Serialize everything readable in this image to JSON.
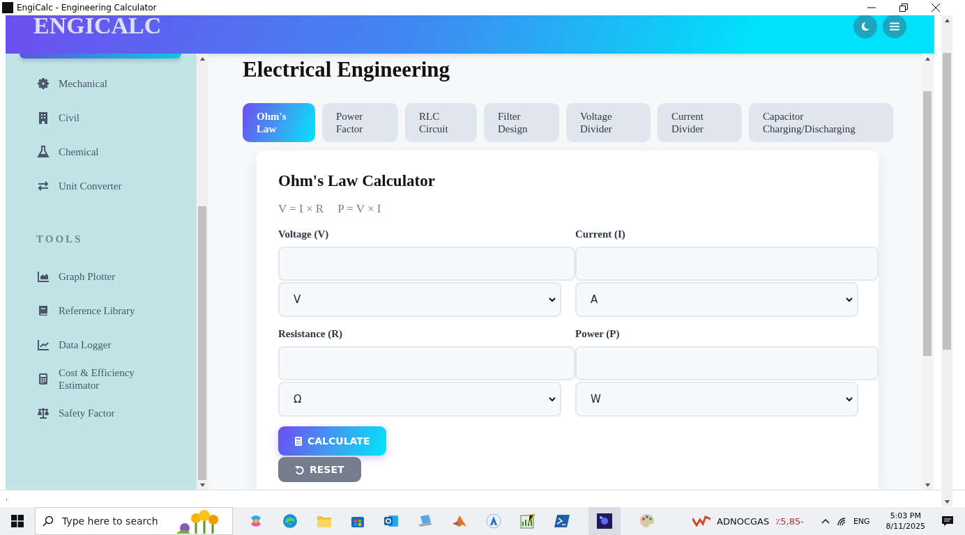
{
  "window": {
    "title": "EngiCalc - Engineering Calculator"
  },
  "header": {
    "logo": "ENGICALC"
  },
  "sidebar": {
    "sections": [
      {
        "items": [
          {
            "label": "Mechanical"
          },
          {
            "label": "Civil"
          },
          {
            "label": "Chemical"
          },
          {
            "label": "Unit Converter"
          }
        ]
      },
      {
        "heading": "TOOLS",
        "items": [
          {
            "label": "Graph Plotter"
          },
          {
            "label": "Reference Library"
          },
          {
            "label": "Data Logger"
          },
          {
            "label": "Cost & Efficiency Estimator"
          },
          {
            "label": "Safety Factor"
          }
        ]
      }
    ]
  },
  "main": {
    "title": "Electrical Engineering",
    "tabs": [
      {
        "label": "Ohm's Law",
        "selected": true
      },
      {
        "label": "Power Factor",
        "selected": false
      },
      {
        "label": "RLC Circuit",
        "selected": false
      },
      {
        "label": "Filter Design",
        "selected": false
      },
      {
        "label": "Voltage Divider",
        "selected": false
      },
      {
        "label": "Current Divider",
        "selected": false
      },
      {
        "label": "Capacitor Charging/Discharging",
        "selected": false
      }
    ],
    "calculator": {
      "title": "Ohm's Law Calculator",
      "formulas": [
        "V = I × R",
        "P = V × I"
      ],
      "fields": [
        {
          "label": "Voltage (V)",
          "unit": "V"
        },
        {
          "label": "Current (I)",
          "unit": "A"
        },
        {
          "label": "Resistance (R)",
          "unit": "Ω"
        },
        {
          "label": "Power (P)",
          "unit": "W"
        }
      ],
      "buttons": [
        {
          "label": "CALCULATE",
          "kind": "primary"
        },
        {
          "label": "RESET",
          "kind": "secondary"
        }
      ]
    }
  },
  "status_line": ".",
  "taskbar": {
    "search": {
      "placeholder": "Type here to search"
    },
    "stock": {
      "name": "ADNOCGAS",
      "change": "٪5,85-"
    },
    "language": "ENG",
    "time": "5:03 PM",
    "date": "8/11/2025"
  }
}
